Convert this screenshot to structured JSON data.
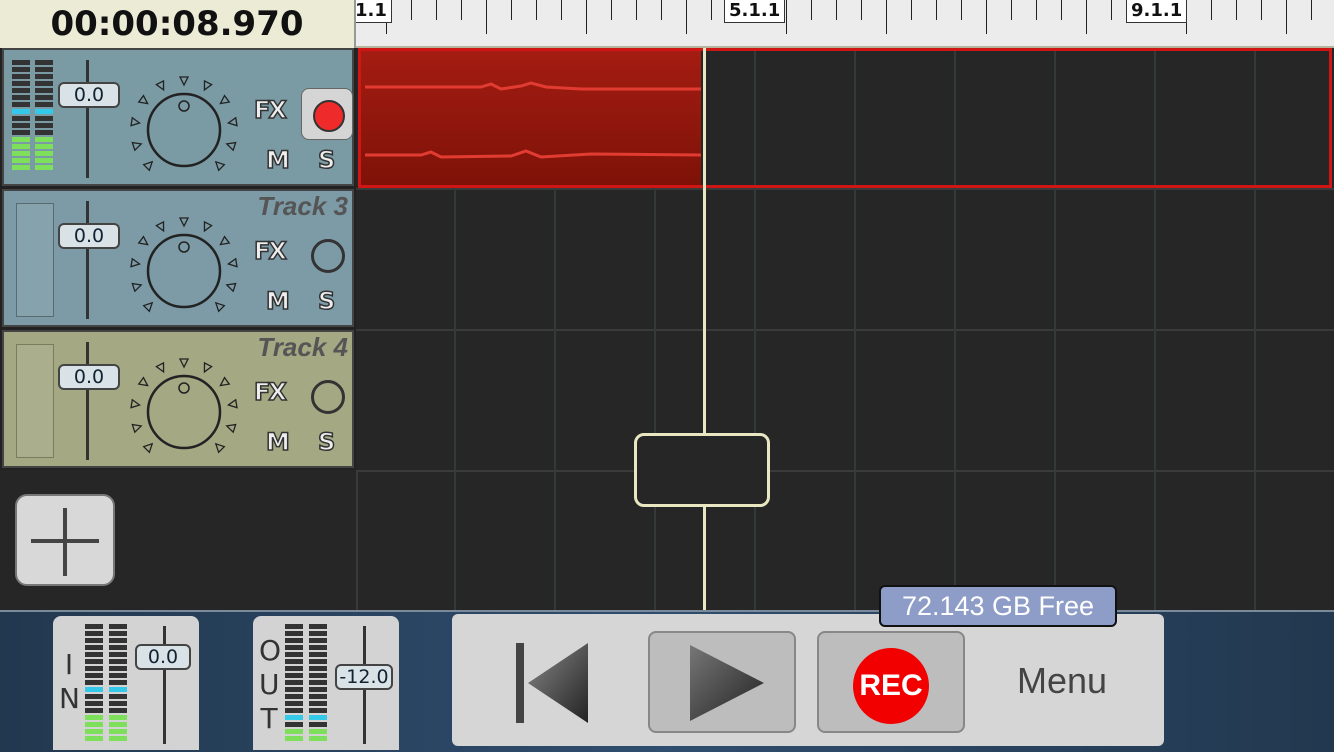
{
  "time_display": "00:00:08.970",
  "ruler": {
    "labels": [
      "1.1",
      "5.1.1",
      "9.1.1"
    ]
  },
  "tracks": [
    {
      "name": "",
      "volume": "0.0",
      "fx_label": "FX",
      "mute_label": "M",
      "solo_label": "S",
      "armed": true
    },
    {
      "name": "Track 3",
      "volume": "0.0",
      "fx_label": "FX",
      "mute_label": "M",
      "solo_label": "S",
      "armed": false
    },
    {
      "name": "Track 4",
      "volume": "0.0",
      "fx_label": "FX",
      "mute_label": "M",
      "solo_label": "S",
      "armed": false
    }
  ],
  "input": {
    "label_letters": [
      "I",
      "N"
    ],
    "volume": "0.0"
  },
  "output": {
    "label_letters": [
      "O",
      "U",
      "T"
    ],
    "volume": "-12.0"
  },
  "transport": {
    "rec_label": "REC",
    "menu_label": "Menu"
  },
  "storage": {
    "free_text": "72.143 GB Free"
  },
  "colors": {
    "recording_clip": "#a41c12",
    "rec_button": "#f20000",
    "playhead": "#e8e7c2",
    "track_blue": "#7c9ba6",
    "track_olive": "#a4a883"
  }
}
